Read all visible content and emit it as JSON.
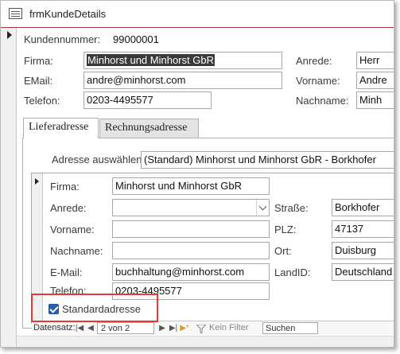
{
  "window": {
    "title": "frmKundeDetails"
  },
  "main": {
    "kundennummer_label": "Kundennummer:",
    "kundennummer_value": "99000001",
    "firma_label": "Firma:",
    "firma_value": "Minhorst und Minhorst GbR",
    "email_label": "EMail:",
    "email_value": "andre@minhorst.com",
    "telefon_label": "Telefon:",
    "telefon_value": "0203-4495577",
    "anrede_label": "Anrede:",
    "anrede_value": "Herr",
    "vorname_label": "Vorname:",
    "vorname_value": "Andre",
    "nachname_label": "Nachname:",
    "nachname_value": "Minh"
  },
  "tabs": [
    {
      "label": "Lieferadresse",
      "active": true
    },
    {
      "label": "Rechnungsadresse",
      "active": false
    }
  ],
  "address_select": {
    "label": "Adresse auswählen:",
    "value": "(Standard) Minhorst und Minhorst GbR - Borkhofer"
  },
  "subform": {
    "firma_label": "Firma:",
    "firma_value": "Minhorst und Minhorst GbR",
    "anrede_label": "Anrede:",
    "anrede_value": "",
    "vorname_label": "Vorname:",
    "vorname_value": "",
    "nachname_label": "Nachname:",
    "nachname_value": "",
    "email_label": "E-Mail:",
    "email_value": "buchhaltung@minhorst.com",
    "telefon_label": "Telefon:",
    "telefon_value": "0203-4495577",
    "strasse_label": "Straße:",
    "strasse_value": "Borkhofer",
    "plz_label": "PLZ:",
    "plz_value": "47137",
    "ort_label": "Ort:",
    "ort_value": "Duisburg",
    "landid_label": "LandID:",
    "landid_value": "Deutschland",
    "standard_label": "Standardadresse",
    "standard_checked": true
  },
  "nav": {
    "record_label": "Datensatz:",
    "record_position": "2 von 2",
    "filter_label": "Kein Filter",
    "search_label": "Suchen"
  },
  "colors": {
    "accent": "#a4373a",
    "highlight": "#e53935",
    "checkbox": "#2b5fad"
  }
}
